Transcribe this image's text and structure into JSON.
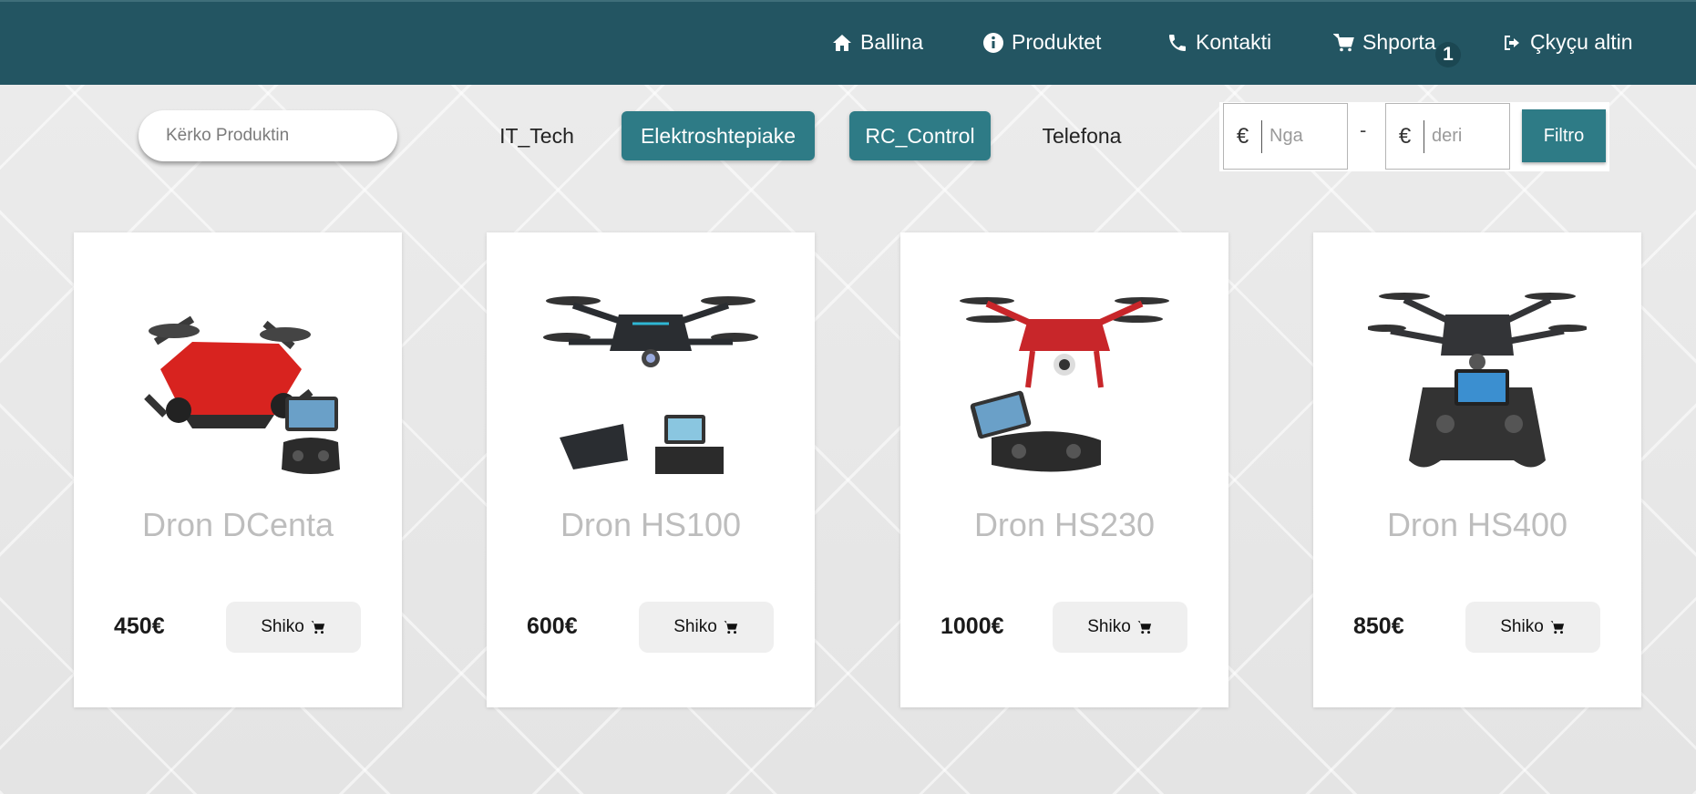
{
  "nav": {
    "items": [
      {
        "label": "Ballina",
        "icon": "home-icon"
      },
      {
        "label": "Produktet",
        "icon": "info-icon"
      },
      {
        "label": "Kontakti",
        "icon": "phone-icon"
      },
      {
        "label": "Shporta",
        "icon": "cart-icon"
      },
      {
        "label": "Çkyçu altin",
        "icon": "logout-icon"
      }
    ],
    "cart_count": "1"
  },
  "search": {
    "placeholder": "Kërko Produktin"
  },
  "categories": [
    {
      "label": "IT_Tech",
      "active": false
    },
    {
      "label": "Elektroshtepiake",
      "active": true
    },
    {
      "label": "RC_Control",
      "active": true
    },
    {
      "label": "Telefona",
      "active": false
    }
  ],
  "price_filter": {
    "currency": "€",
    "from_placeholder": "Nga",
    "separator": "-",
    "to_placeholder": "deri",
    "button_label": "Filtro"
  },
  "products": [
    {
      "title": "Dron DCenta",
      "price": "450€",
      "button_label": "Shiko",
      "drone_color": "#d8231f"
    },
    {
      "title": "Dron HS100",
      "price": "600€",
      "button_label": "Shiko",
      "drone_color": "#2a2d31"
    },
    {
      "title": "Dron HS230",
      "price": "1000€",
      "button_label": "Shiko",
      "drone_color": "#c8262a"
    },
    {
      "title": "Dron HS400",
      "price": "850€",
      "button_label": "Shiko",
      "drone_color": "#333437"
    }
  ],
  "colors": {
    "nav_bg": "#235562",
    "accent": "#2e7b86"
  }
}
